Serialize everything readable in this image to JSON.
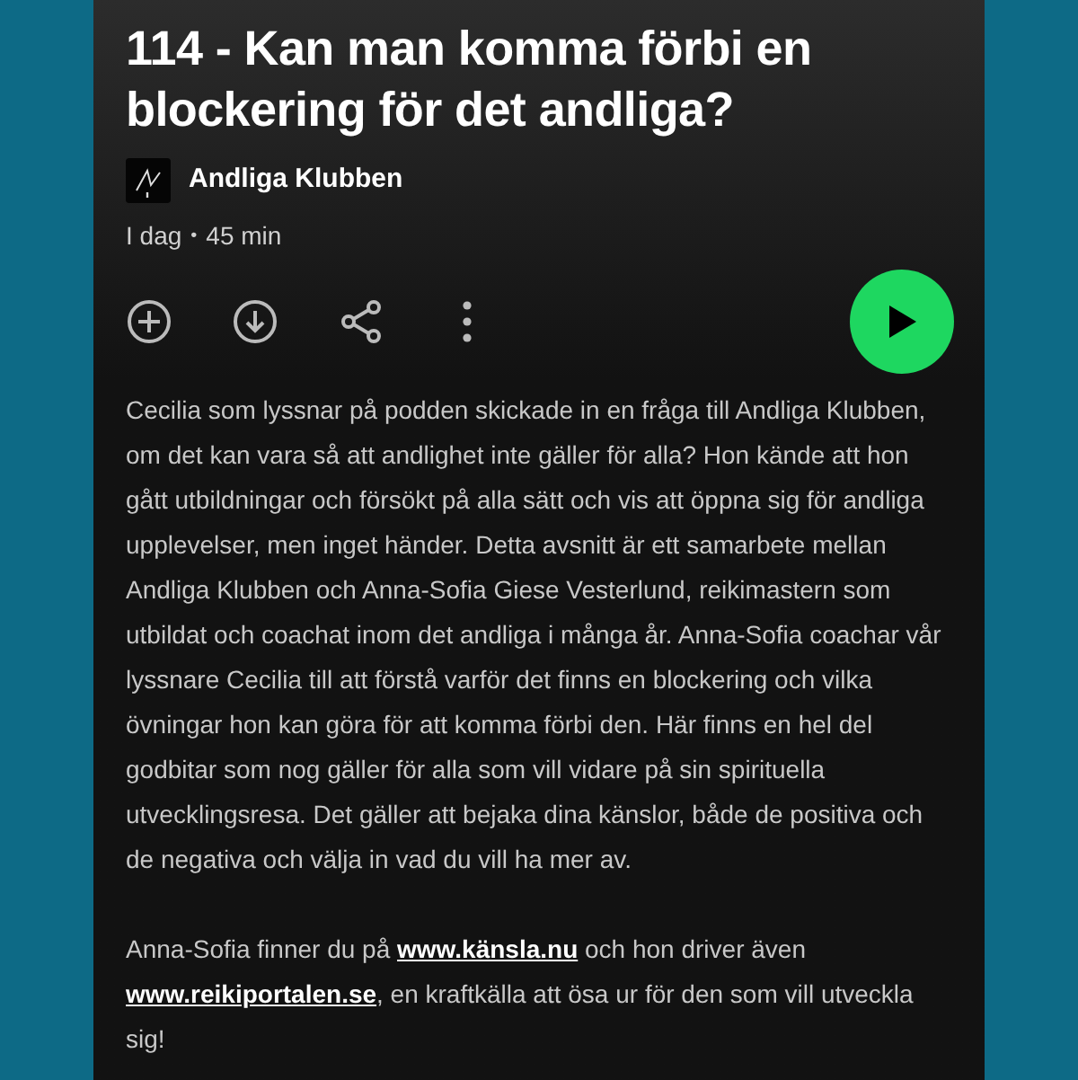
{
  "episode": {
    "title": "114 - Kan man komma förbi en blockering för det andliga?",
    "show": "Andliga Klubben",
    "date": "I dag",
    "separator": "•",
    "duration": "45 min"
  },
  "actions": [
    {
      "kind": "add"
    },
    {
      "kind": "download"
    },
    {
      "kind": "share"
    },
    {
      "kind": "more"
    }
  ],
  "description": [
    "Cecilia som lyssnar på podden skickade in en fråga till Andliga Klubben, om det kan vara så att andlighet inte gäller för alla? Hon kände att hon gått utbildningar och försökt på alla sätt och vis att öppna sig för andliga upplevelser, men inget händer. Detta avsnitt är ett samarbete mellan Andliga Klubben och Anna-Sofia Giese Vesterlund, reikimastern som utbildat och coachat inom det andliga i många år. Anna-Sofia coachar vår lyssnare Cecilia till att förstå varför det finns en blockering och vilka övningar hon kan göra för att komma förbi den. Här finns en hel del godbitar som nog gäller för alla som vill vidare på sin spirituella utvecklingsresa. Det gäller att bejaka dina känslor, både de positiva och de negativa och välja in vad du vill ha mer av."
  ],
  "links_paragraph": [
    {
      "kind": "text",
      "text": "Anna-Sofia finner du på "
    },
    {
      "kind": "link",
      "text": "www.känsla.nu"
    },
    {
      "kind": "text",
      "text": " och hon driver även "
    },
    {
      "kind": "link",
      "text": "www.reikiportalen.se"
    },
    {
      "kind": "text",
      "text": ", en kraftkälla att ösa ur för den som vill utveckla sig!"
    }
  ]
}
